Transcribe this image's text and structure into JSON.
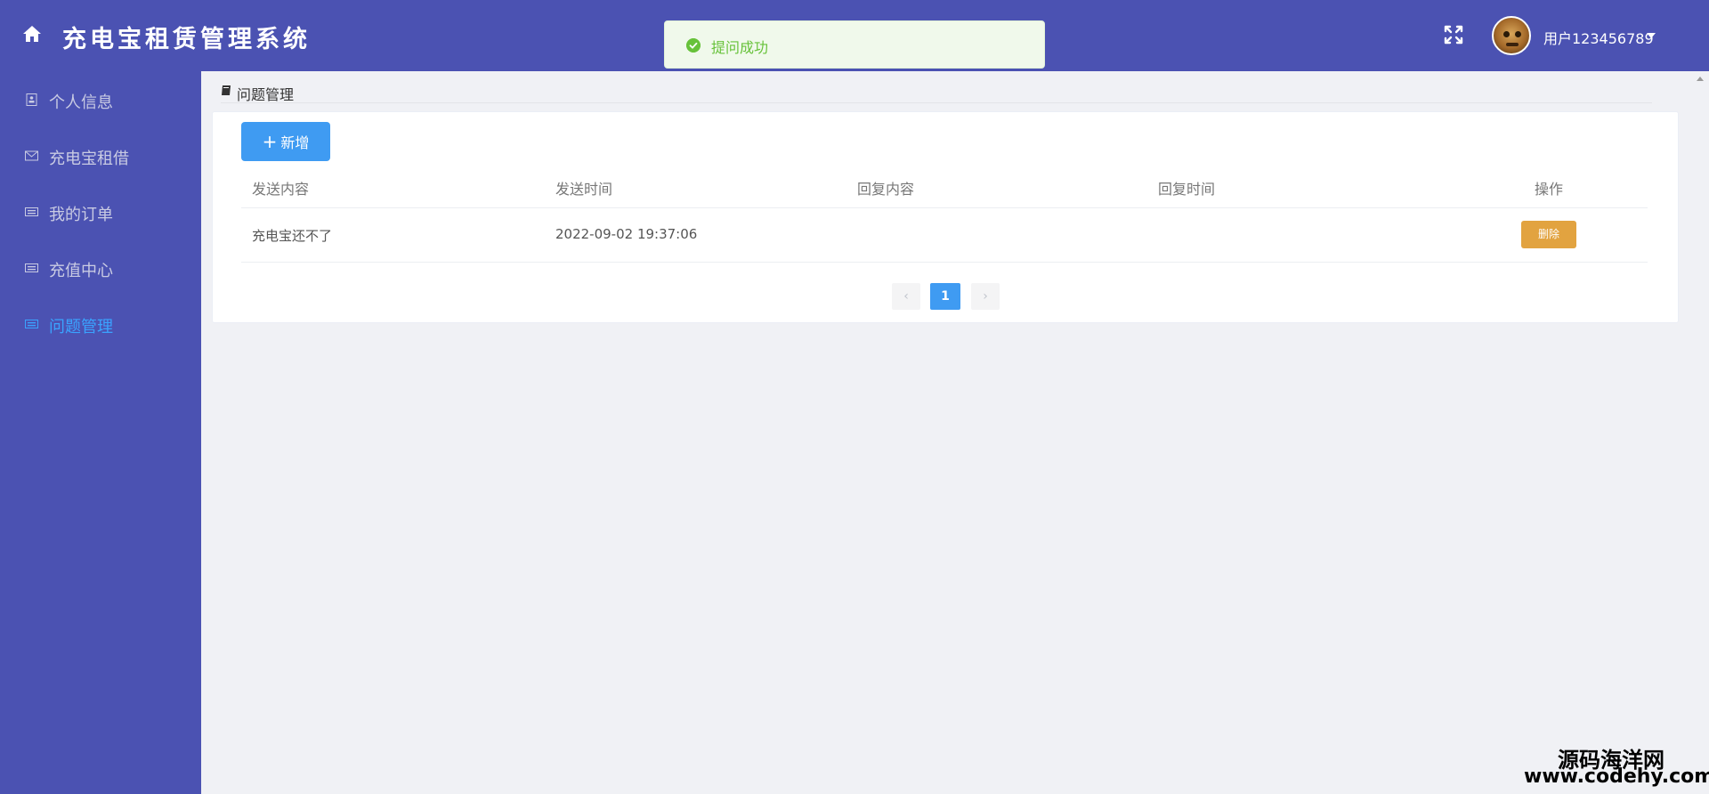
{
  "header": {
    "title": "充电宝租赁管理系统",
    "username": "用户123456789"
  },
  "toast": {
    "message": "提问成功"
  },
  "sidebar": {
    "items": [
      {
        "label": "个人信息",
        "icon": "id-card-icon",
        "active": false
      },
      {
        "label": "充电宝租借",
        "icon": "envelope-icon",
        "active": false
      },
      {
        "label": "我的订单",
        "icon": "keyboard-icon",
        "active": false
      },
      {
        "label": "充值中心",
        "icon": "keyboard-icon",
        "active": false
      },
      {
        "label": "问题管理",
        "icon": "keyboard-icon",
        "active": true
      }
    ]
  },
  "breadcrumb": {
    "label": "问题管理",
    "icon": "book-icon"
  },
  "toolbar": {
    "add_label": "新增",
    "add_icon": "+"
  },
  "table": {
    "columns": [
      "发送内容",
      "发送时间",
      "回复内容",
      "回复时间",
      "操作"
    ],
    "rows": [
      {
        "content": "充电宝还不了",
        "send_time": "2022-09-02 19:37:06",
        "reply": "",
        "reply_time": "",
        "action": "删除"
      }
    ]
  },
  "pagination": {
    "prev": "‹",
    "current": "1",
    "next": "›"
  },
  "watermark": {
    "title": "源码海洋网",
    "url": "www.codehy.com"
  },
  "colors": {
    "primary": "#4b52b2",
    "accent": "#3f9bf2",
    "warning": "#e2a340",
    "success": "#67c23a"
  }
}
